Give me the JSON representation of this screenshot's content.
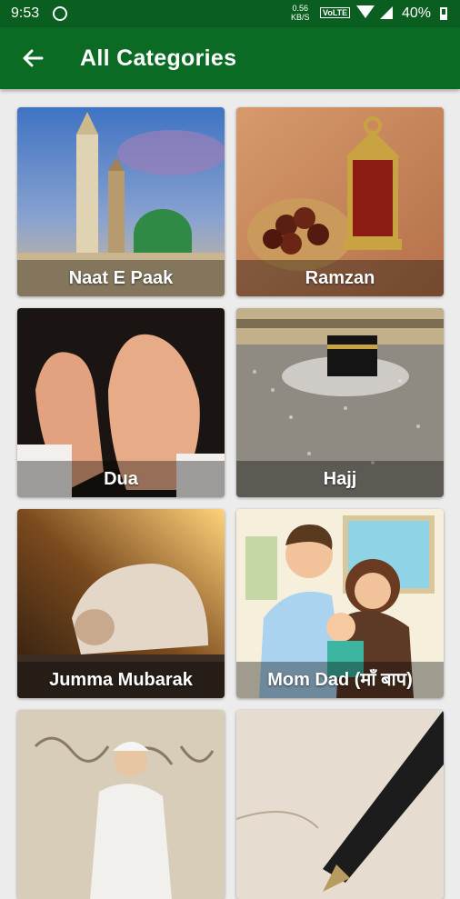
{
  "status_bar": {
    "time": "9:53",
    "speed_value": "0.56",
    "speed_unit": "KB/S",
    "network": "VoLTE",
    "battery": "40%"
  },
  "app_bar": {
    "title": "All Categories",
    "back_icon": "arrow-left-icon"
  },
  "categories": [
    {
      "label": "Naat E Paak"
    },
    {
      "label": "Ramzan"
    },
    {
      "label": "Dua"
    },
    {
      "label": "Hajj"
    },
    {
      "label": "Jumma Mubarak"
    },
    {
      "label": "Mom Dad (माँ बाप)"
    },
    {
      "label": ""
    },
    {
      "label": ""
    }
  ],
  "colors": {
    "status_bar": "#0a5e20",
    "app_bar": "#0b6b24",
    "background": "#ececec"
  }
}
